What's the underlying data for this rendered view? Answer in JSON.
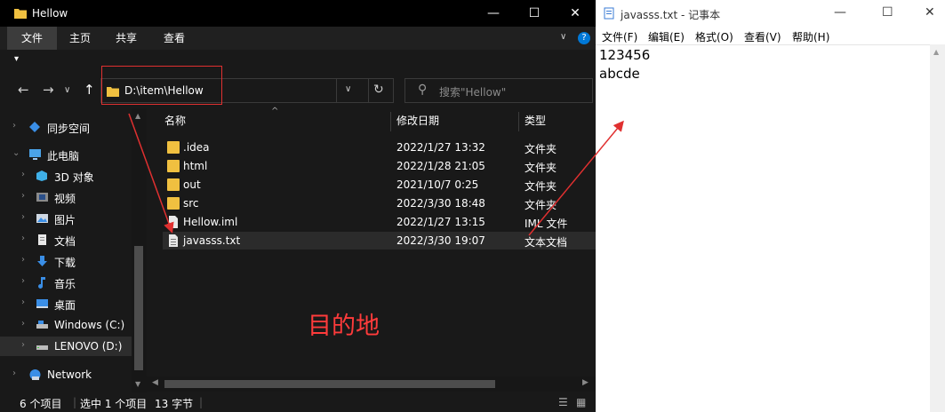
{
  "explorer": {
    "title": "Hellow",
    "window_buttons": {
      "minimize": "—",
      "maximize": "☐",
      "close": "✕"
    },
    "ribbon_tabs": [
      "文件",
      "主页",
      "共享",
      "查看"
    ],
    "help_icon": "?",
    "address": "D:\\item\\Hellow",
    "search_placeholder": "搜索\"Hellow\"",
    "sidebar": [
      {
        "label": "同步空间",
        "icon": "sync-icon"
      },
      {
        "label": "此电脑",
        "icon": "computer-icon"
      },
      {
        "label": "3D 对象",
        "icon": "cube-icon"
      },
      {
        "label": "视频",
        "icon": "video-icon"
      },
      {
        "label": "图片",
        "icon": "picture-icon"
      },
      {
        "label": "文档",
        "icon": "document-icon"
      },
      {
        "label": "下载",
        "icon": "download-icon"
      },
      {
        "label": "音乐",
        "icon": "music-icon"
      },
      {
        "label": "桌面",
        "icon": "desktop-icon"
      },
      {
        "label": "Windows (C:)",
        "icon": "drive-icon"
      },
      {
        "label": "LENOVO (D:)",
        "icon": "drive-icon"
      },
      {
        "label": "Network",
        "icon": "network-icon"
      }
    ],
    "columns": {
      "name": "名称",
      "date": "修改日期",
      "type": "类型"
    },
    "files": [
      {
        "name": ".idea",
        "date": "2022/1/27 13:32",
        "type": "文件夹",
        "kind": "folder"
      },
      {
        "name": "html",
        "date": "2022/1/28 21:05",
        "type": "文件夹",
        "kind": "folder"
      },
      {
        "name": "out",
        "date": "2021/10/7 0:25",
        "type": "文件夹",
        "kind": "folder"
      },
      {
        "name": "src",
        "date": "2022/3/30 18:48",
        "type": "文件夹",
        "kind": "folder"
      },
      {
        "name": "Hellow.iml",
        "date": "2022/1/27 13:15",
        "type": "IML 文件",
        "kind": "file"
      },
      {
        "name": "javasss.txt",
        "date": "2022/3/30 19:07",
        "type": "文本文档",
        "kind": "file"
      }
    ],
    "annotation": "目的地",
    "status": {
      "count": "6 个项目",
      "selected": "选中 1 个项目",
      "size": "13 字节"
    }
  },
  "notepad": {
    "title": "javasss.txt - 记事本",
    "menu": [
      "文件(F)",
      "编辑(E)",
      "格式(O)",
      "查看(V)",
      "帮助(H)"
    ],
    "lines": [
      "123456",
      "abcde"
    ]
  },
  "colors": {
    "folder": "#f0c040",
    "annotation": "#e03030",
    "accent": "#0078d7"
  }
}
